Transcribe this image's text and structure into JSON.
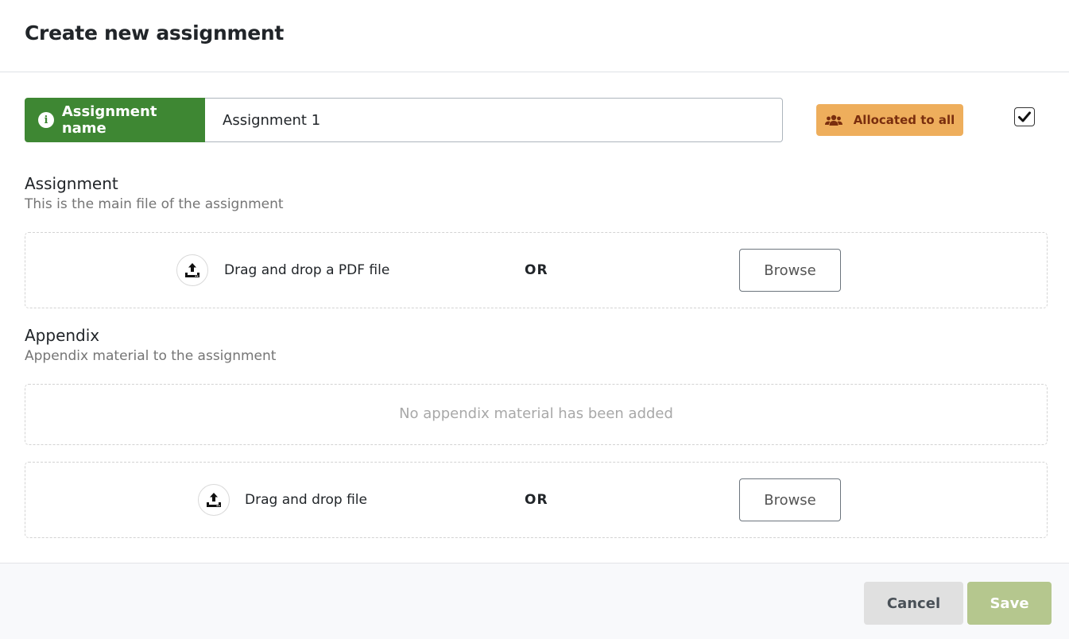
{
  "dialog": {
    "title": "Create new assignment"
  },
  "name_field": {
    "label": "Assignment name",
    "value": "Assignment 1",
    "info_icon": "info-circle-icon"
  },
  "allocation": {
    "label": "Allocated to all",
    "icon": "users-icon",
    "color": "#eeae5c",
    "checked": true
  },
  "assignment_section": {
    "title": "Assignment",
    "subtitle": "This is the main file of the assignment",
    "dropzone": {
      "text": "Drag and drop a PDF file",
      "or_label": "OR",
      "browse_label": "Browse",
      "icon": "upload-icon"
    }
  },
  "appendix_section": {
    "title": "Appendix",
    "subtitle": "Appendix material to the assignment",
    "empty_message": "No appendix material has been added",
    "dropzone": {
      "text": "Drag and drop file",
      "or_label": "OR",
      "browse_label": "Browse",
      "icon": "upload-icon"
    }
  },
  "footer": {
    "cancel_label": "Cancel",
    "save_label": "Save"
  },
  "colors": {
    "primary_green": "#3e8733",
    "save_disabled": "#b5c78e",
    "badge_orange": "#eeae5c"
  }
}
